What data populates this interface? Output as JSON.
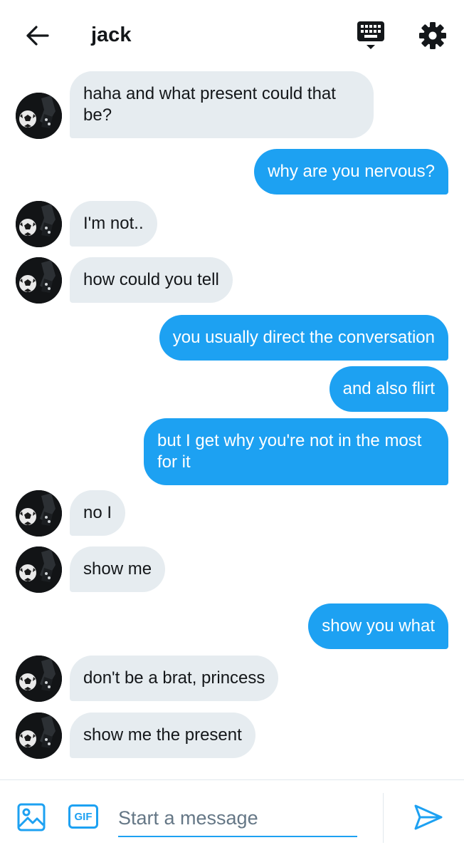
{
  "header": {
    "title": "jack",
    "back_icon": "arrow-left-icon",
    "keyboard_icon": "keyboard-icon",
    "settings_icon": "gear-icon"
  },
  "messages": [
    {
      "from": "them",
      "text": "haha and what present could that be?"
    },
    {
      "from": "me",
      "text": "why are you nervous?"
    },
    {
      "from": "them",
      "text": "I'm not.."
    },
    {
      "from": "them",
      "text": "how could you tell"
    },
    {
      "from": "me",
      "text": "you usually direct the conversation"
    },
    {
      "from": "me",
      "text": "and also flirt"
    },
    {
      "from": "me",
      "text": "but I get why you're not in the most for it"
    },
    {
      "from": "them",
      "text": "no I"
    },
    {
      "from": "them",
      "text": "show me"
    },
    {
      "from": "me",
      "text": "show you what"
    },
    {
      "from": "them",
      "text": "don't be a brat, princess"
    },
    {
      "from": "them",
      "text": "show me the present"
    }
  ],
  "composer": {
    "placeholder": "Start a message",
    "gif_label": "GIF",
    "media_icon": "image-icon",
    "send_icon": "send-icon"
  },
  "colors": {
    "accent": "#1da1f2",
    "incoming_bubble": "#e6ecf0",
    "text": "#14171a"
  }
}
